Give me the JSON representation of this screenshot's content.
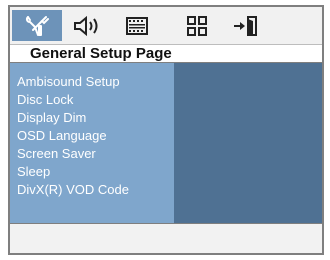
{
  "tabs": [
    {
      "icon": "general-setup-icon",
      "active": true
    },
    {
      "icon": "audio-setup-icon",
      "active": false
    },
    {
      "icon": "video-setup-icon",
      "active": false
    },
    {
      "icon": "preference-setup-icon",
      "active": false
    },
    {
      "icon": "exit-icon",
      "active": false
    }
  ],
  "page_title": "General Setup Page",
  "menu": {
    "items": [
      {
        "label": "Ambisound Setup"
      },
      {
        "label": "Disc Lock"
      },
      {
        "label": "Display Dim"
      },
      {
        "label": "OSD Language"
      },
      {
        "label": "Screen Saver"
      },
      {
        "label": "Sleep"
      },
      {
        "label": "DivX(R) VOD Code"
      }
    ]
  },
  "colors": {
    "active_tab": "#6d93b9",
    "menu_background": "#7fa6cc",
    "panel_background": "#4f7193",
    "menu_text": "#ffffff"
  }
}
